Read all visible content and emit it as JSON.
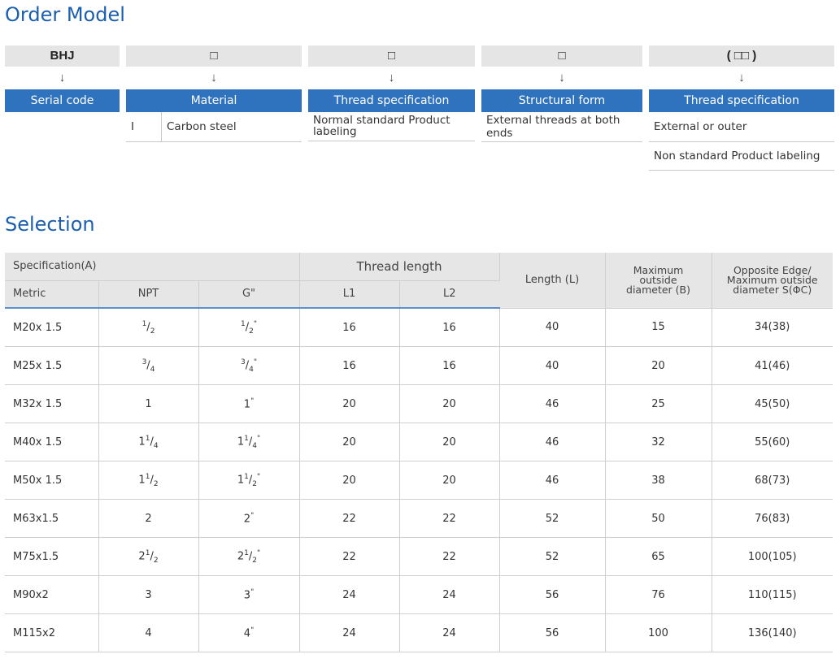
{
  "order_model": {
    "title": "Order Model",
    "columns": [
      {
        "code": "BHJ",
        "label": "Serial code",
        "options": []
      },
      {
        "code": "□",
        "label": "Material",
        "options": [
          {
            "key": "I",
            "text": "Carbon steel"
          }
        ]
      },
      {
        "code": "□",
        "label": "Thread specification",
        "options": [
          {
            "text": "Normal standard Product labeling"
          }
        ]
      },
      {
        "code": "□",
        "label": "Structural form",
        "options": [
          {
            "text": "External threads at both ends"
          }
        ]
      },
      {
        "code": "( □□ )",
        "label": "Thread specification",
        "options": [
          {
            "text": "External or outer"
          },
          {
            "text": "Non standard Product labeling"
          }
        ]
      }
    ],
    "arrow": "↓"
  },
  "selection": {
    "title": "Selection",
    "headers": {
      "spec_group": "Specification(A)",
      "metric": "Metric",
      "npt": "NPT",
      "g": "G\"",
      "thread_length": "Thread length",
      "l1": "L1",
      "l2": "L2",
      "length": "Length (L)",
      "max_od": "Maximum outside diameter (B)",
      "opposite": "Opposite Edge/ Maximum outside diameter S(ΦC)"
    },
    "rows": [
      {
        "metric": "M20x 1.5",
        "npt": {
          "whole": "",
          "num": "1",
          "den": "2"
        },
        "g_suffix": "\"",
        "l1": "16",
        "l2": "16",
        "length": "40",
        "max_od": "15",
        "opposite": "34(38)"
      },
      {
        "metric": "M25x 1.5",
        "npt": {
          "whole": "",
          "num": "3",
          "den": "4"
        },
        "g_suffix": "\"",
        "l1": "16",
        "l2": "16",
        "length": "40",
        "max_od": "20",
        "opposite": "41(46)"
      },
      {
        "metric": "M32x 1.5",
        "npt": {
          "whole": "1",
          "num": "",
          "den": ""
        },
        "g_suffix": "\"",
        "l1": "20",
        "l2": "20",
        "length": "46",
        "max_od": "25",
        "opposite": "45(50)"
      },
      {
        "metric": "M40x 1.5",
        "npt": {
          "whole": "1",
          "num": "1",
          "den": "4"
        },
        "g_suffix": "\"",
        "l1": "20",
        "l2": "20",
        "length": "46",
        "max_od": "32",
        "opposite": "55(60)"
      },
      {
        "metric": "M50x 1.5",
        "npt": {
          "whole": "1",
          "num": "1",
          "den": "2"
        },
        "g_suffix": "\"",
        "l1": "20",
        "l2": "20",
        "length": "46",
        "max_od": "38",
        "opposite": "68(73)"
      },
      {
        "metric": "M63x1.5",
        "npt": {
          "whole": "2",
          "num": "",
          "den": ""
        },
        "g_suffix": "\"",
        "l1": "22",
        "l2": "22",
        "length": "52",
        "max_od": "50",
        "opposite": "76(83)"
      },
      {
        "metric": "M75x1.5",
        "npt": {
          "whole": "2",
          "num": "1",
          "den": "2"
        },
        "g_suffix": "\"",
        "l1": "22",
        "l2": "22",
        "length": "52",
        "max_od": "65",
        "opposite": "100(105)"
      },
      {
        "metric": "M90x2",
        "npt": {
          "whole": "3",
          "num": "",
          "den": ""
        },
        "g_suffix": "\"",
        "l1": "24",
        "l2": "24",
        "length": "56",
        "max_od": "76",
        "opposite": "110(115)"
      },
      {
        "metric": "M115x2",
        "npt": {
          "whole": "4",
          "num": "",
          "den": ""
        },
        "g_suffix": "\"",
        "l1": "24",
        "l2": "24",
        "length": "56",
        "max_od": "100",
        "opposite": "136(140)"
      }
    ]
  },
  "colors": {
    "title": "#1b5fae",
    "label_bar": "#2f73bf",
    "code_bar": "#e5e5e5",
    "header_rule": "#5b8fcf"
  }
}
